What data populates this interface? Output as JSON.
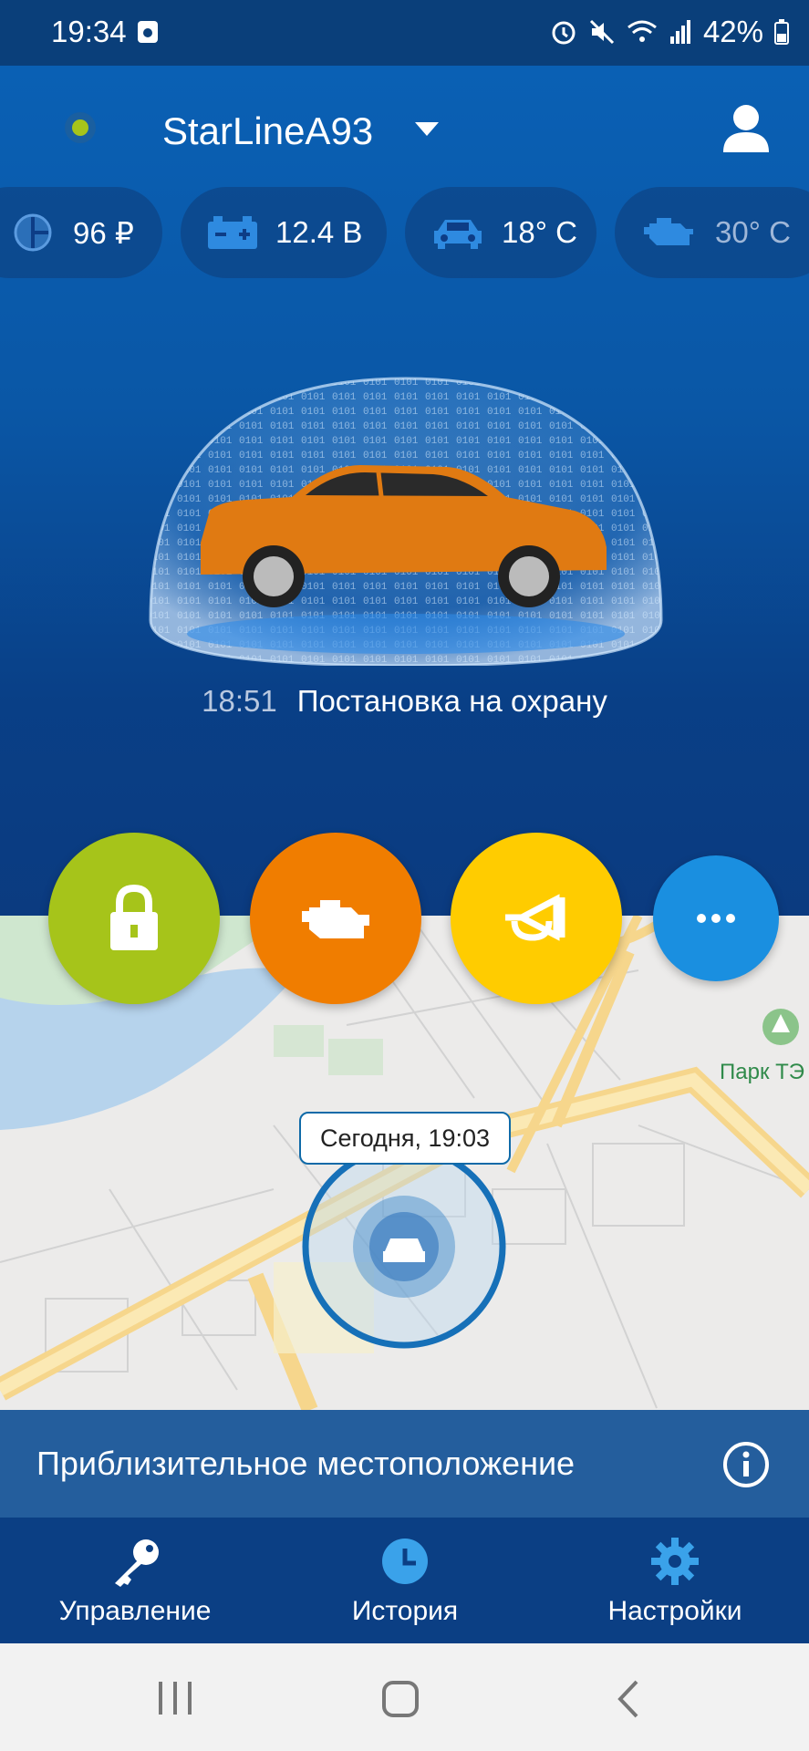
{
  "status_bar": {
    "time": "19:34",
    "battery": "42%"
  },
  "header": {
    "device_name": "StarLineA93"
  },
  "chips": [
    {
      "icon": "balance-icon",
      "value": "96 ₽"
    },
    {
      "icon": "battery-icon",
      "value": "12.4 В"
    },
    {
      "icon": "car-icon",
      "value": "18° C"
    },
    {
      "icon": "engine-icon",
      "value": "30° C"
    }
  ],
  "event": {
    "time": "18:51",
    "text": "Постановка на охрану"
  },
  "map": {
    "tooltip": "Сегодня, 19:03",
    "park_label": "Парк ТЭ"
  },
  "location_bar": {
    "text": "Приблизительное местоположение"
  },
  "nav": [
    {
      "label": "Управление",
      "icon": "key-icon"
    },
    {
      "label": "История",
      "icon": "clock-icon"
    },
    {
      "label": "Настройки",
      "icon": "gear-icon"
    }
  ],
  "colors": {
    "arm": "#a6c41a",
    "engine": "#f07d00",
    "horn": "#ffcc00",
    "more": "#1a8fe0"
  }
}
